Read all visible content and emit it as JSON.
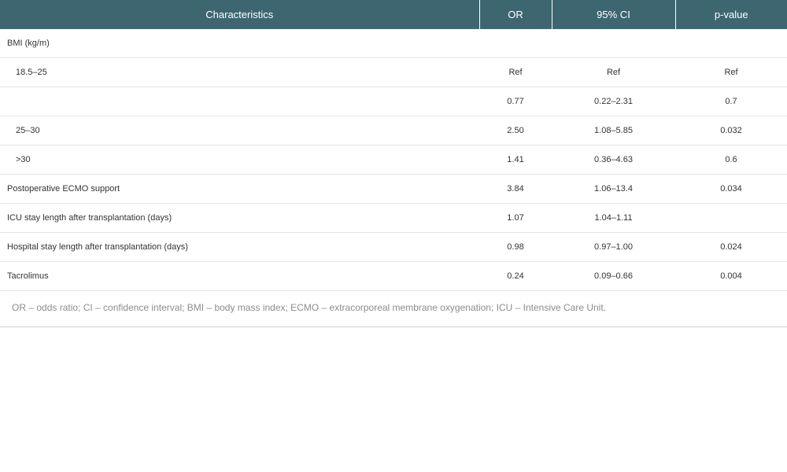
{
  "table": {
    "headers": [
      "Characteristics",
      "OR",
      "95% CI",
      "p-value"
    ],
    "rows": [
      {
        "label": "BMI (kg/m)",
        "or": "",
        "ci": "",
        "p": ""
      },
      {
        "label": "18.5–25",
        "or": "Ref",
        "ci": "Ref",
        "p": "Ref"
      },
      {
        "label": "",
        "or": "0.77",
        "ci": "0.22–2.31",
        "p": "0.7"
      },
      {
        "label": "25–30",
        "or": "2.50",
        "ci": "1.08–5.85",
        "p": "0.032"
      },
      {
        "label": ">30",
        "or": "1.41",
        "ci": "0.36–4.63",
        "p": "0.6"
      },
      {
        "label": "Postoperative ECMO support",
        "or": "3.84",
        "ci": "1.06–13.4",
        "p": "0.034"
      },
      {
        "label": "ICU stay length after transplantation (days)",
        "or": "1.07",
        "ci": "1.04–1.11",
        "p": ""
      },
      {
        "label": "Hospital stay length after transplantation (days)",
        "or": "0.98",
        "ci": "0.97–1.00",
        "p": "0.024"
      },
      {
        "label": "Tacrolimus",
        "or": "0.24",
        "ci": "0.09–0.66",
        "p": "0.004"
      }
    ]
  },
  "footnote": "OR – odds ratio; CI – confidence interval; BMI – body mass index; ECMO – extracorporeal membrane oxygenation; ICU – Intensive Care Unit.",
  "colors": {
    "header_bg": "#3d6670",
    "header_text": "#ffffff",
    "row_border": "#e3e3e3",
    "footnote_text": "#8c8c8c"
  }
}
